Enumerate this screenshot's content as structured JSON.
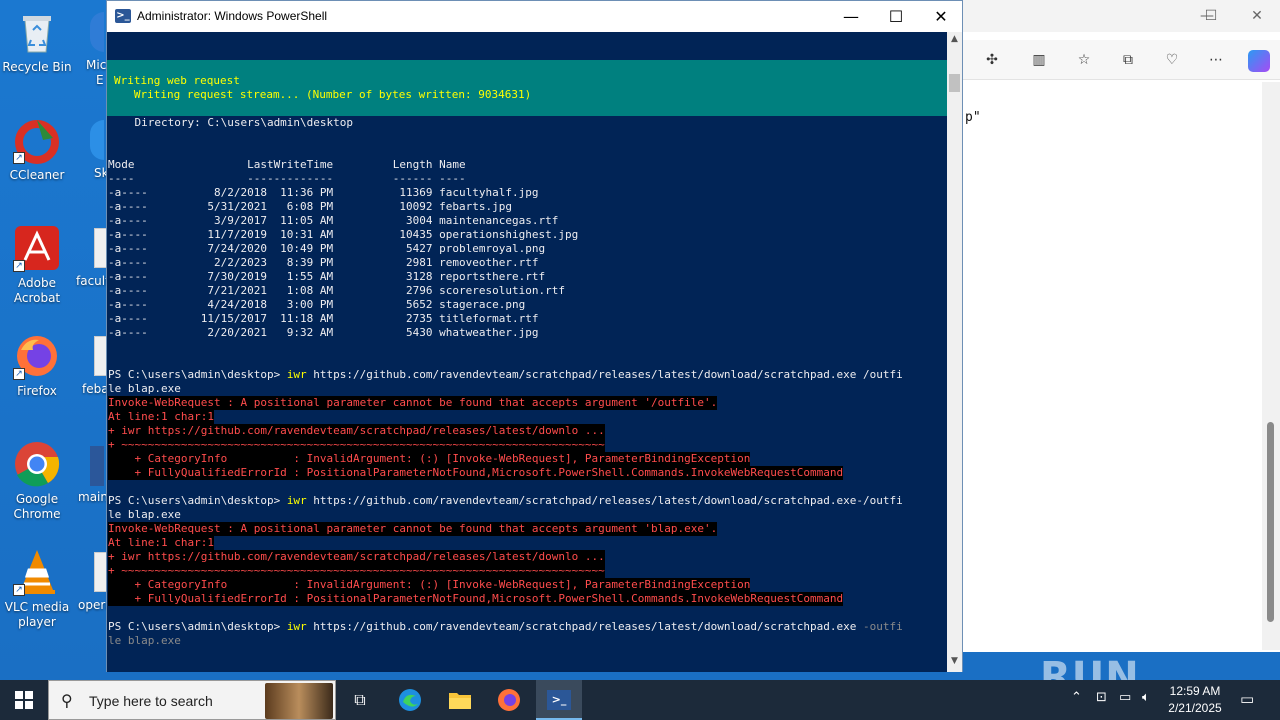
{
  "desktop_icons": [
    {
      "name": "recycle-bin",
      "label": "Recycle Bin"
    },
    {
      "name": "ccleaner",
      "label": "CCleaner"
    },
    {
      "name": "adobe-acrobat",
      "label": "Adobe Acrobat"
    },
    {
      "name": "firefox",
      "label": "Firefox"
    },
    {
      "name": "google-chrome",
      "label": "Google Chrome"
    },
    {
      "name": "vlc-media-player",
      "label": "VLC media player"
    }
  ],
  "desktop_partial_labels": [
    "Mic",
    "E",
    "Sk",
    "facult",
    "febar",
    "main",
    "opera"
  ],
  "edge": {
    "snippet": "p\""
  },
  "powershell": {
    "title": "Administrator: Windows PowerShell",
    "progress_line1": "Writing web request",
    "progress_line2": "   Writing request stream... (Number of bytes written: 9034631)",
    "directory": "    Directory: C:\\users\\admin\\desktop",
    "header": "Mode                 LastWriteTime         Length Name",
    "header_sep": "----                 -------------         ------ ----",
    "files": [
      "-a----          8/2/2018  11:36 PM          11369 facultyhalf.jpg",
      "-a----         5/31/2021   6:08 PM          10092 febarts.jpg",
      "-a----          3/9/2017  11:05 AM           3004 maintenancegas.rtf",
      "-a----         11/7/2019  10:31 AM          10435 operationshighest.jpg",
      "-a----         7/24/2020  10:49 PM           5427 problemroyal.png",
      "-a----          2/2/2023   8:39 PM           2981 removeother.rtf",
      "-a----         7/30/2019   1:55 AM           3128 reportsthere.rtf",
      "-a----         7/21/2021   1:08 AM           2796 scoreresolution.rtf",
      "-a----         4/24/2018   3:00 PM           5652 stagerace.png",
      "-a----        11/15/2017  11:18 AM           2735 titleformat.rtf",
      "-a----         2/20/2021   9:32 AM           5430 whatweather.jpg"
    ],
    "cmd1_prompt": "PS C:\\users\\admin\\desktop> ",
    "cmd1_keyword": "iwr",
    "cmd1_rest": " https://github.com/ravendevteam/scratchpad/releases/latest/download/scratchpad.exe /outfi",
    "cmd1_wrap": "le blap.exe",
    "err1_line1": "Invoke-WebRequest : A positional parameter cannot be found that accepts argument '/outfile'.",
    "err1_line2": "At line:1 char:1",
    "err1_line3": "+ iwr https://github.com/ravendevteam/scratchpad/releases/latest/downlo ...",
    "err1_line4": "+ ~~~~~~~~~~~~~~~~~~~~~~~~~~~~~~~~~~~~~~~~~~~~~~~~~~~~~~~~~~~~~~~~~~~~~~~~~",
    "err1_line5": "    + CategoryInfo          : InvalidArgument: (:) [Invoke-WebRequest], ParameterBindingException",
    "err1_line6": "    + FullyQualifiedErrorId : PositionalParameterNotFound,Microsoft.PowerShell.Commands.InvokeWebRequestCommand",
    "cmd2_prompt": "PS C:\\users\\admin\\desktop> ",
    "cmd2_keyword": "iwr",
    "cmd2_rest": " https://github.com/ravendevteam/scratchpad/releases/latest/download/scratchpad.exe-/outfi",
    "cmd2_wrap": "le blap.exe",
    "err2_line1": "Invoke-WebRequest : A positional parameter cannot be found that accepts argument 'blap.exe'.",
    "err2_line2": "At line:1 char:1",
    "err2_line3": "+ iwr https://github.com/ravendevteam/scratchpad/releases/latest/downlo ...",
    "err2_line4": "+ ~~~~~~~~~~~~~~~~~~~~~~~~~~~~~~~~~~~~~~~~~~~~~~~~~~~~~~~~~~~~~~~~~~~~~~~~~",
    "err2_line5": "    + CategoryInfo          : InvalidArgument: (:) [Invoke-WebRequest], ParameterBindingException",
    "err2_line6": "    + FullyQualifiedErrorId : PositionalParameterNotFound,Microsoft.PowerShell.Commands.InvokeWebRequestCommand",
    "cmd3_prompt": "PS C:\\users\\admin\\desktop> ",
    "cmd3_keyword": "iwr",
    "cmd3_rest": " https://github.com/ravendevteam/scratchpad/releases/latest/download/scratchpad.exe ",
    "cmd3_dim": "-outfi",
    "cmd3_wrap": "le blap.exe"
  },
  "taskbar": {
    "search_placeholder": "Type here to search",
    "time": "12:59 AM",
    "date": "2/21/2025"
  },
  "watermark": "ANY RUN",
  "colors": {
    "console_bg": "#012456",
    "progress_bg": "#00807f",
    "error_fg": "#ff4c4c",
    "command_fg": "#ffff00"
  }
}
